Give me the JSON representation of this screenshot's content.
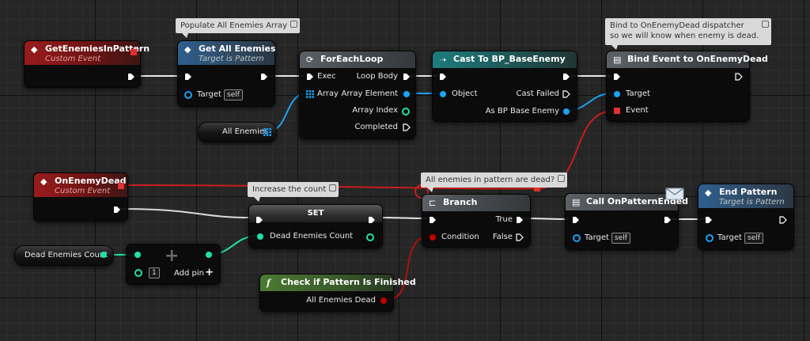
{
  "comments": {
    "populate": "Populate All Enemies Array",
    "bind_line1": "Bind to OnEnemyDead dispatcher",
    "bind_line2": "so we will know when enemy is dead.",
    "increase": "Increase the count",
    "all_dead": "All enemies in pattern are dead?"
  },
  "nodes": {
    "get_enemies_in_pattern": {
      "title": "GetEnemiesInPattern",
      "subtitle": "Custom Event"
    },
    "get_all_enemies": {
      "title": "Get All Enemies",
      "subtitle": "Target is Pattern",
      "target_label": "Target",
      "target_default": "self"
    },
    "for_each_loop": {
      "title": "ForEachLoop",
      "exec": "Exec",
      "array": "Array",
      "loop_body": "Loop Body",
      "array_element": "Array Element",
      "array_index": "Array Index",
      "completed": "Completed"
    },
    "cast": {
      "title": "Cast To BP_BaseEnemy",
      "object": "Object",
      "cast_failed": "Cast Failed",
      "as_enemy": "As BP Base Enemy"
    },
    "bind_event": {
      "title": "Bind Event to OnEnemyDead",
      "target": "Target",
      "event": "Event"
    },
    "all_enemies_var": {
      "label": "All Enemies"
    },
    "on_enemy_dead": {
      "title": "OnEnemyDead",
      "subtitle": "Custom Event"
    },
    "set": {
      "title": "SET",
      "dead_enemies_count": "Dead Enemies Count"
    },
    "dead_count_var": {
      "label": "Dead Enemies Count"
    },
    "increment": {
      "value": "1",
      "add_pin": "Add pin"
    },
    "branch": {
      "title": "Branch",
      "condition": "Condition",
      "true": "True",
      "false": "False"
    },
    "check_pattern": {
      "title": "Check if Pattern Is Finished",
      "output": "All Enemies Dead"
    },
    "call_pattern_ended": {
      "title": "Call OnPatternEnded",
      "target": "Target",
      "target_default": "self"
    },
    "end_pattern": {
      "title": "End Pattern",
      "subtitle": "Target is Pattern",
      "target": "Target",
      "target_default": "self"
    }
  },
  "icons": {
    "event": "diamond-icon",
    "loop": "loop-icon",
    "cast": "cast-arrows-icon",
    "bind": "bind-event-icon",
    "branch": "branch-icon",
    "function": "function-icon",
    "message": "envelope-icon",
    "array": "grid-icon",
    "plus": "plus-icon"
  },
  "colors": {
    "exec_pin": "#ffffff",
    "object_pin": "#1da1f2",
    "int_pin": "#1fe0a8",
    "bool_pin": "#c00000",
    "delegate_pin": "#e03030"
  }
}
